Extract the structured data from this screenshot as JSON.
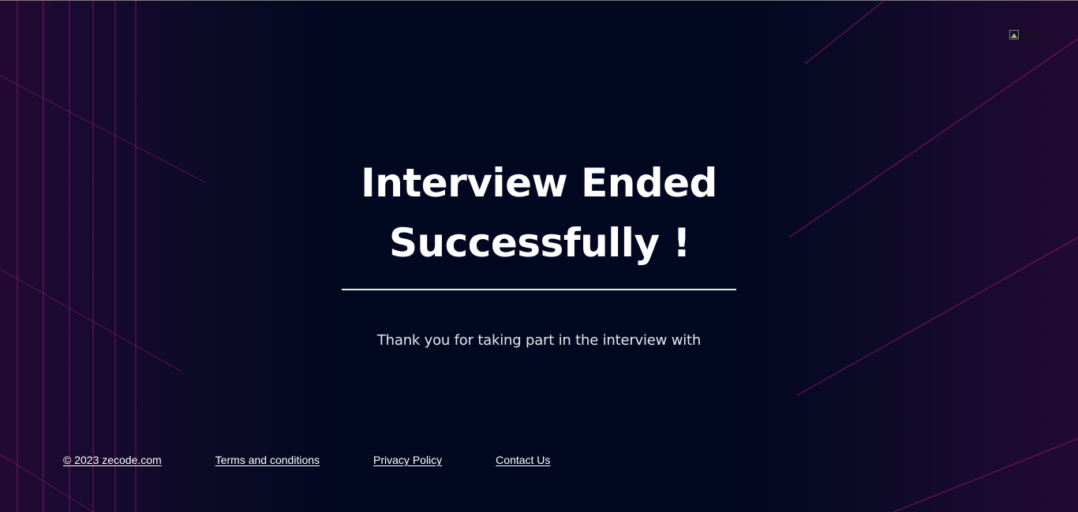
{
  "header": {
    "logo_alt": "logo"
  },
  "main": {
    "title_line1": "Interview Ended",
    "title_line2": "Successfully !",
    "message": "Thank you for taking part in the interview with"
  },
  "footer": {
    "copyright": "© 2023 zecode.com",
    "terms": "Terms and conditions",
    "privacy": "Privacy Policy",
    "contact": "Contact Us"
  },
  "theme": {
    "background": "#020820",
    "accent_line": "#b0197f",
    "text": "#ffffff"
  },
  "icons": {
    "logo": "broken-image-icon"
  }
}
